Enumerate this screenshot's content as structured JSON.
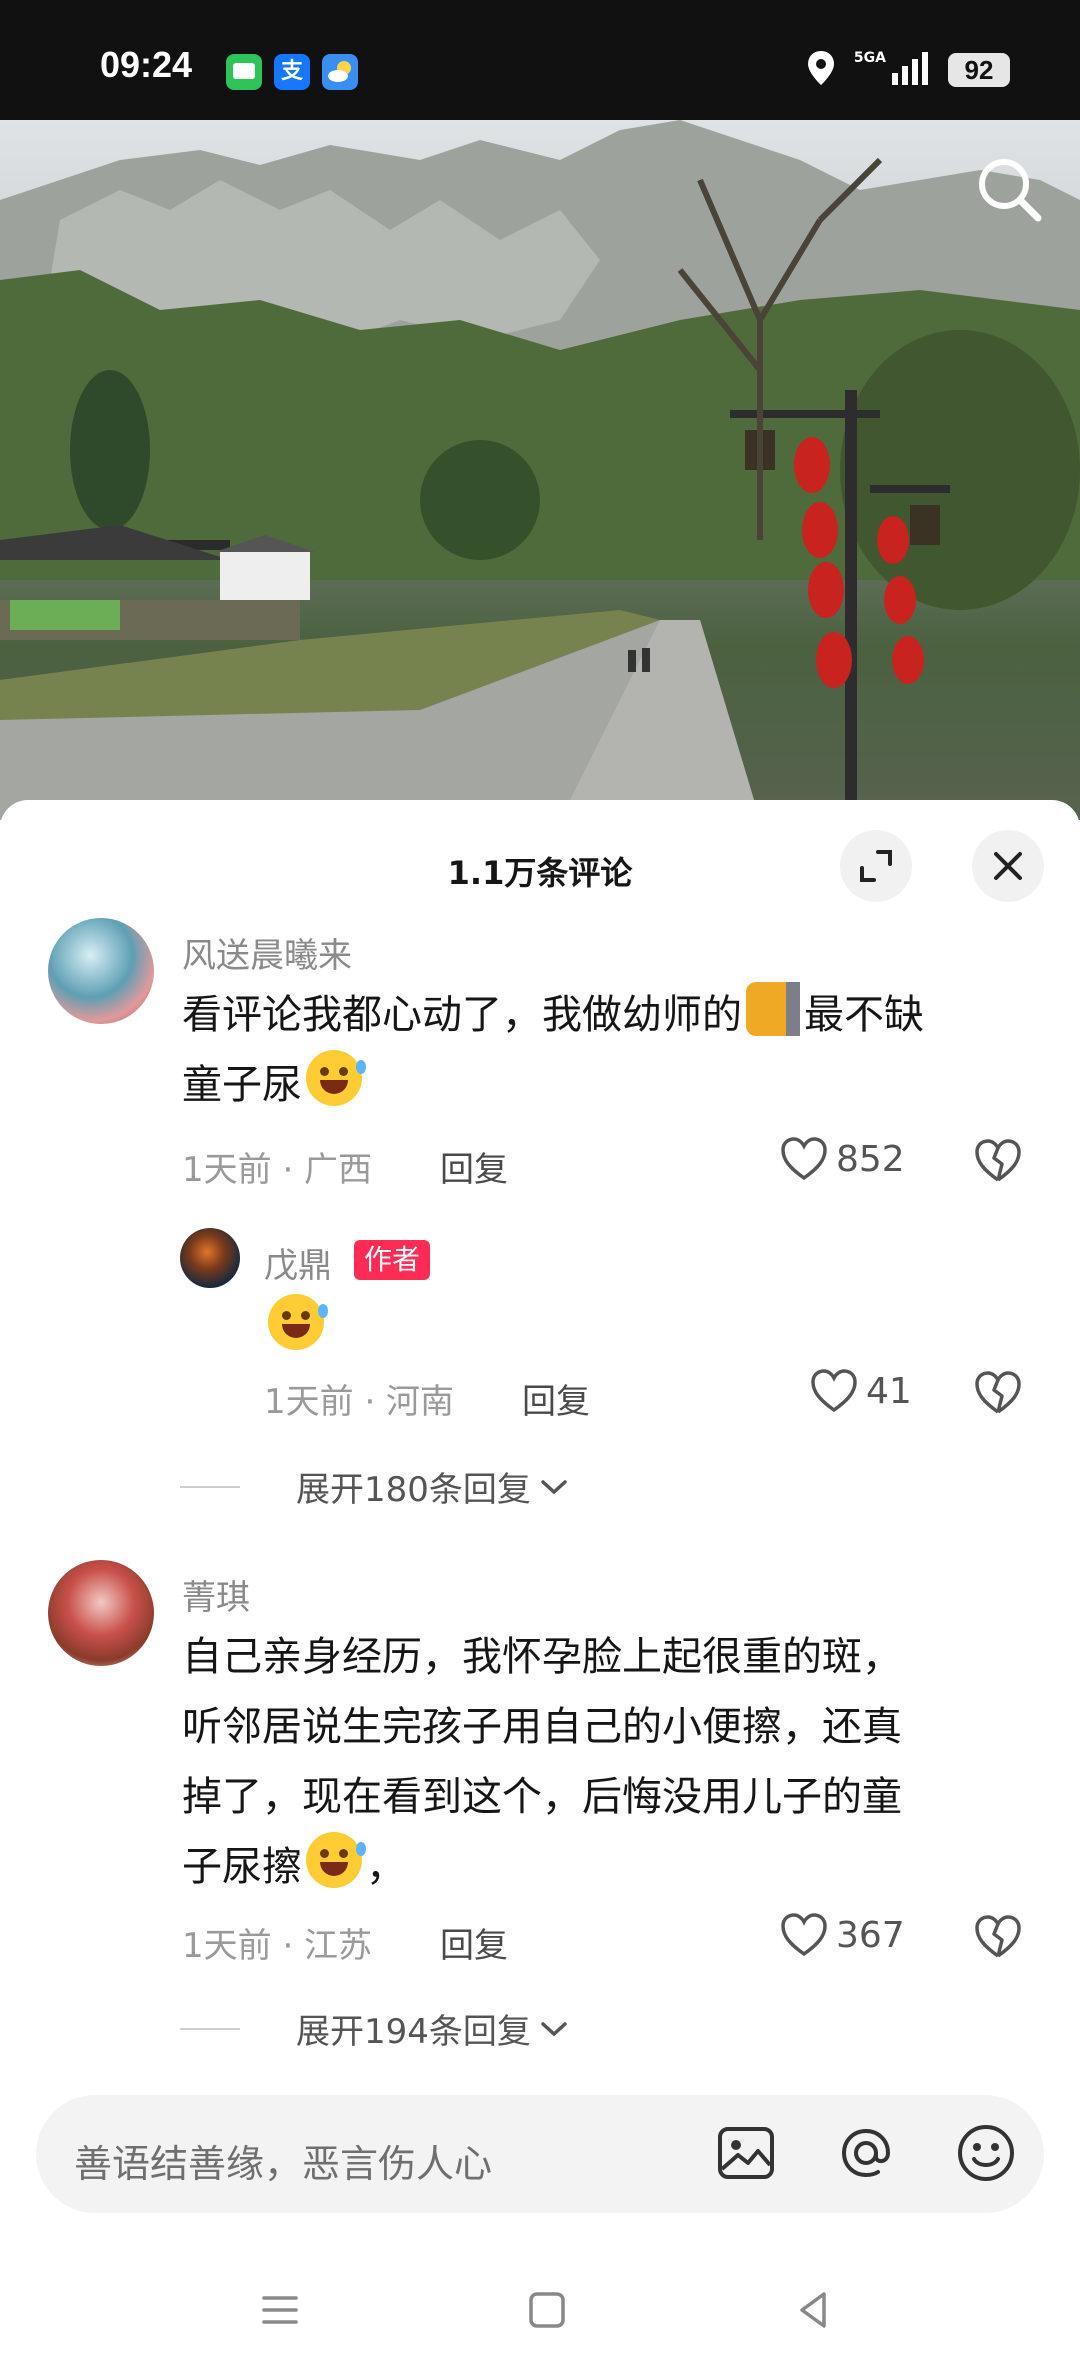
{
  "status_bar": {
    "time": "09:24",
    "app_icons": [
      {
        "name": "message-icon",
        "color": "#2ec45a",
        "glyph": "▬"
      },
      {
        "name": "alipay-icon",
        "color": "#1677ff",
        "glyph": "支"
      },
      {
        "name": "weather-icon",
        "color": "#3a8ef0",
        "glyph": "☁"
      }
    ],
    "network_label": "5GA",
    "battery": "92"
  },
  "sheet": {
    "title": "1.1万条评论"
  },
  "comments": [
    {
      "username": "风送晨曦来",
      "text_line1_a": "看评论我都心动了，我做幼师的",
      "text_line1_b": "最不缺",
      "text_line2": "童子尿",
      "meta": "1天前 · 广西",
      "reply_label": "回复",
      "likes": "852"
    },
    {
      "username": "戊鼎",
      "author_tag": "作者",
      "meta": "1天前 · 河南",
      "reply_label": "回复",
      "likes": "41"
    },
    {
      "username": "菁琪",
      "text_line1": "自己亲身经历，我怀孕脸上起很重的斑，",
      "text_line2": "听邻居说生完孩子用自己的小便擦，还真",
      "text_line3": "掉了，现在看到这个，后悔没用儿子的童",
      "text_line4_a": "子尿擦",
      "text_line4_b": "，",
      "meta": "1天前 · 江苏",
      "reply_label": "回复",
      "likes": "367"
    }
  ],
  "expand_replies": [
    {
      "label": "展开180条回复"
    },
    {
      "label": "展开194条回复"
    }
  ],
  "input": {
    "placeholder": "善语结善缘，恶言伤人心"
  },
  "colors": {
    "accent": "#fe2c55",
    "text": "#161616",
    "muted": "#9a9a9a"
  }
}
